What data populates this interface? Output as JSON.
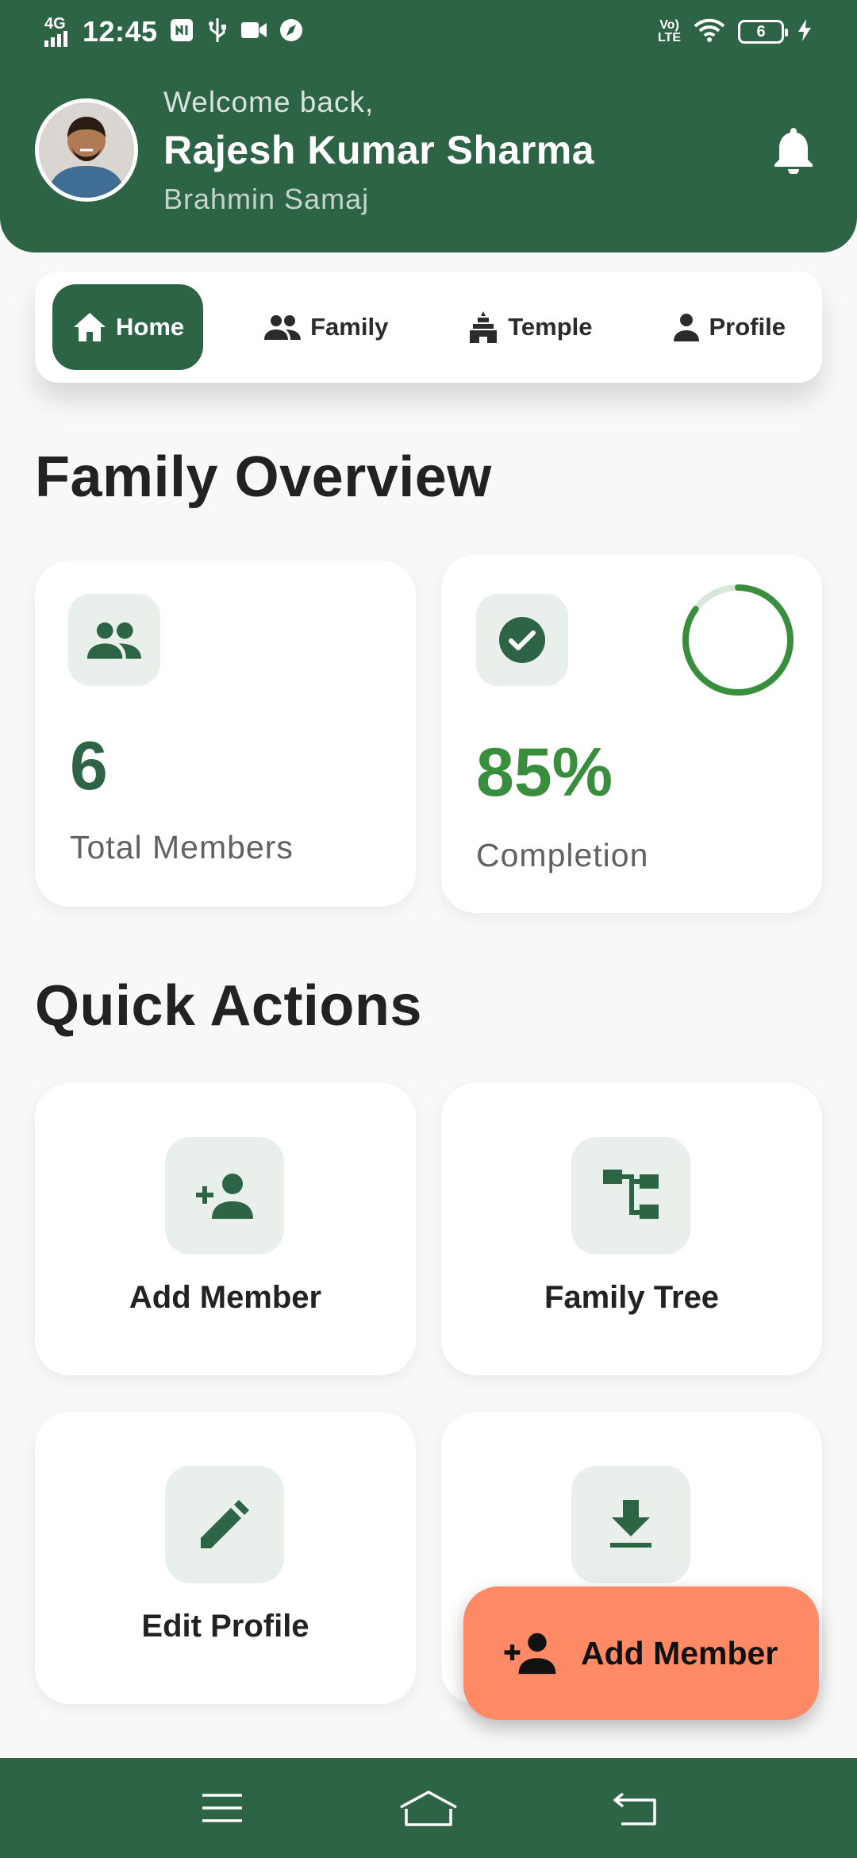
{
  "status_bar": {
    "network": "4G",
    "time": "12:45",
    "battery": "6",
    "icons": [
      "signal-icon",
      "nfc-icon",
      "usb-icon",
      "video-icon",
      "compass-icon",
      "volte-icon",
      "wifi-icon",
      "charging-icon"
    ]
  },
  "header": {
    "welcome": "Welcome back,",
    "name": "Rajesh Kumar Sharma",
    "community": "Brahmin Samaj",
    "bg_color": "#2d6446"
  },
  "tabs": [
    {
      "label": "Home",
      "icon": "home-icon",
      "active": true
    },
    {
      "label": "Family",
      "icon": "people-icon",
      "active": false
    },
    {
      "label": "Temple",
      "icon": "temple-icon",
      "active": false
    },
    {
      "label": "Profile",
      "icon": "person-icon",
      "active": false
    }
  ],
  "overview": {
    "title": "Family Overview",
    "members": {
      "value": "6",
      "label": "Total Members",
      "icon": "people-icon"
    },
    "completion": {
      "value": "85%",
      "label": "Completion",
      "icon": "check-circle-icon",
      "progress": 0.85
    }
  },
  "quick_actions": {
    "title": "Quick Actions",
    "items": [
      {
        "label": "Add Member",
        "icon": "person-add-icon"
      },
      {
        "label": "Family Tree",
        "icon": "tree-icon"
      },
      {
        "label": "Edit Profile",
        "icon": "pencil-icon"
      },
      {
        "label": "",
        "icon": "download-icon"
      }
    ]
  },
  "fab": {
    "label": "Add Member",
    "icon": "person-add-icon",
    "color": "#ff8a65"
  },
  "nav": {
    "icons": [
      "menu-icon",
      "home-icon",
      "back-icon"
    ]
  },
  "colors": {
    "primary": "#2d6446",
    "accent_green": "#388e3c",
    "tile_bg": "#e9efeb"
  }
}
